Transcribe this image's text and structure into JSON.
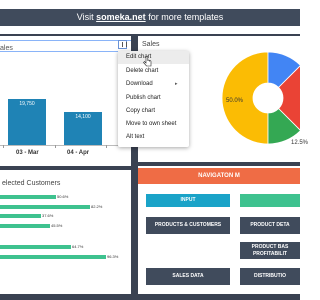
{
  "banner": {
    "prefix": "Visit",
    "link": "someka.net",
    "suffix": "for more templates"
  },
  "left_chart": {
    "title": "ales",
    "bars": [
      {
        "label": "19,750",
        "value": 19750
      },
      {
        "label": "14,100",
        "value": 14100
      }
    ],
    "categories": [
      "03 - Mar",
      "04 - Apr"
    ]
  },
  "customers": {
    "title": "elected Customers",
    "rows": [
      {
        "label": "50.6%",
        "value": 50.6
      },
      {
        "label": "82.2%",
        "value": 82.2
      },
      {
        "label": "37.6%",
        "value": 37.6
      },
      {
        "label": "45.5%",
        "value": 45.5
      },
      {
        "label": "",
        "value": 0
      },
      {
        "label": "64.7%",
        "value": 64.7
      },
      {
        "label": "96.3%",
        "value": 96.3
      }
    ]
  },
  "right_chart": {
    "title": "Sales",
    "slices": [
      {
        "label": "50.0%",
        "value": 50.0,
        "color": "#fbbc04"
      },
      {
        "label": "12.5%",
        "value": 12.5,
        "color": "#4285f4"
      },
      {
        "label": "",
        "value": 25.0,
        "color": "#ea4335"
      },
      {
        "label": "",
        "value": 12.5,
        "color": "#34a853"
      }
    ]
  },
  "nav": {
    "header": "NAVIGATON M",
    "buttons": {
      "input": "INPUT",
      "products_customers": "PRODUCTS & CUSTOMERS",
      "product_details": "PRODUCT DETA",
      "product_based": "PRODUCT BAS PROFITABILIT",
      "sales_data": "SALES DATA",
      "distribution": "DISTRIBUTIO"
    }
  },
  "menu": {
    "items": [
      "Edit chart",
      "Delete chart",
      "Download",
      "Publish chart",
      "Copy chart",
      "Move to own sheet",
      "Alt text"
    ]
  },
  "chart_data": [
    {
      "type": "bar",
      "title": "ales",
      "categories": [
        "03 - Mar",
        "04 - Apr"
      ],
      "values": [
        19750,
        14100
      ]
    },
    {
      "type": "pie",
      "title": "Sales",
      "categories": [
        "",
        "",
        "",
        ""
      ],
      "values": [
        50.0,
        12.5,
        25.0,
        12.5
      ]
    },
    {
      "type": "bar",
      "title": "elected Customers",
      "values": [
        50.6,
        82.2,
        37.6,
        45.5,
        64.7,
        96.3
      ]
    }
  ]
}
